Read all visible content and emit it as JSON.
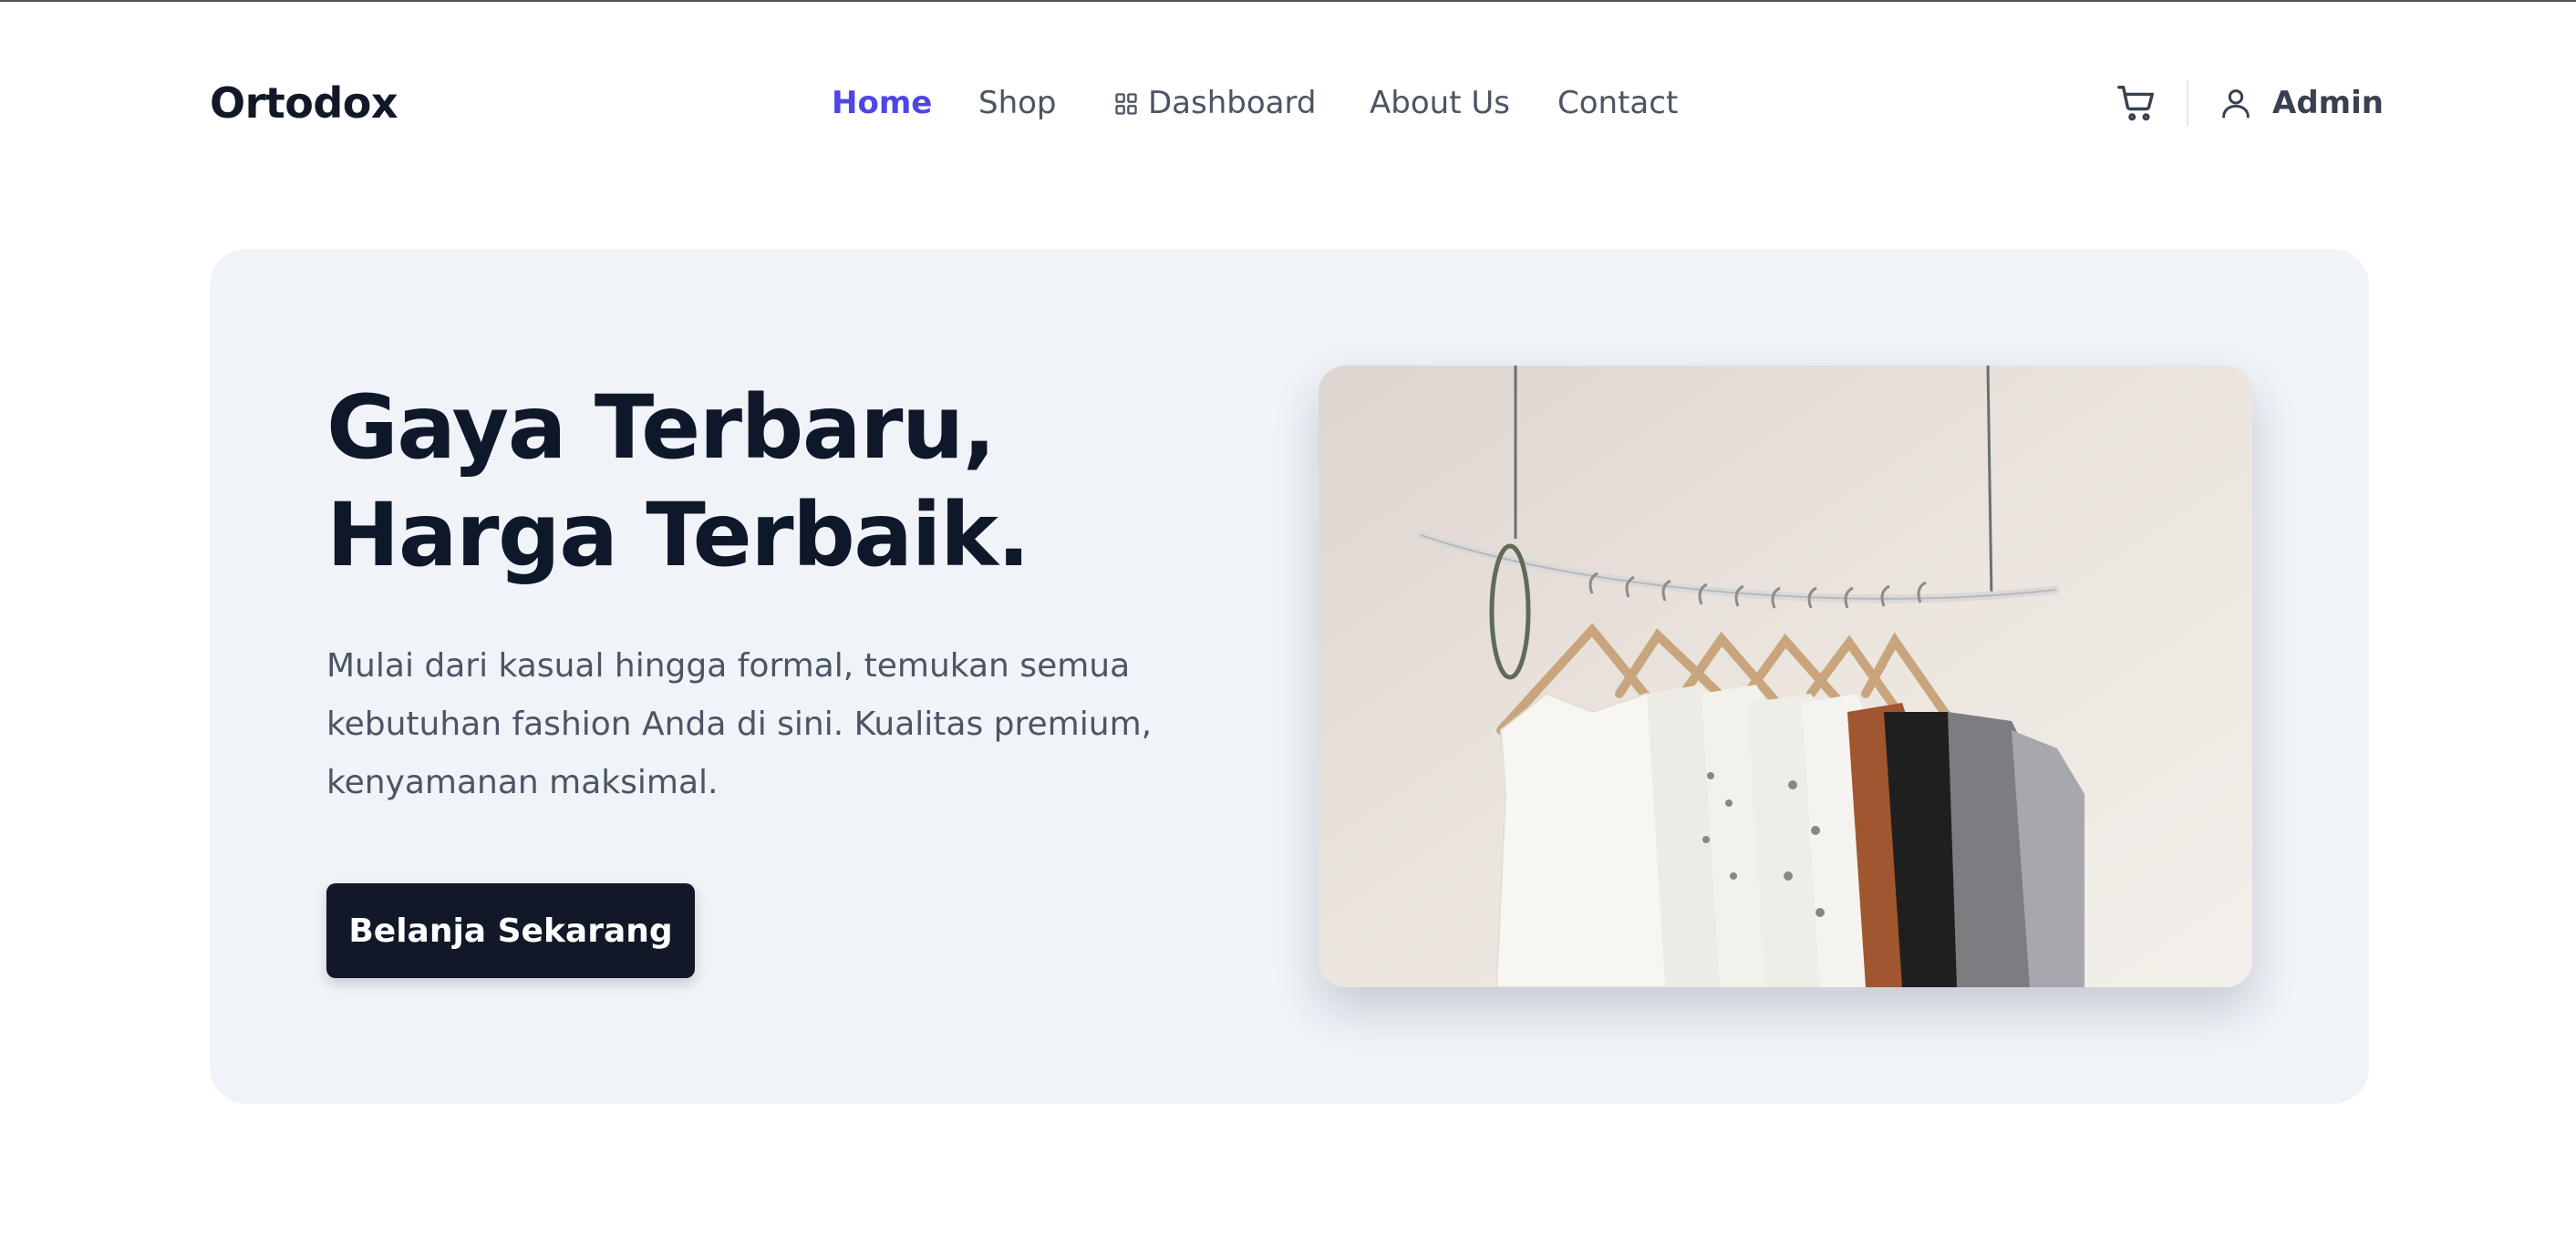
{
  "brand": {
    "name": "Ortodox"
  },
  "nav": {
    "home": "Home",
    "shop": "Shop",
    "dashboard": "Dashboard",
    "about": "About Us",
    "contact": "Contact"
  },
  "user": {
    "name": "Admin"
  },
  "hero": {
    "title": "Gaya Terbaru, Harga Terbaik.",
    "description": "Mulai dari kasual hingga formal, temukan semua kebutuhan fashion Anda di sini. Kualitas premium, kenyamanan maksimal.",
    "cta_label": "Belanja Sekarang"
  },
  "colors": {
    "accent": "#4f46e5",
    "dark": "#111827",
    "hero_bg": "#f0f3f8"
  },
  "icons": {
    "dashboard": "grid-icon",
    "cart": "cart-icon",
    "user": "user-icon"
  }
}
